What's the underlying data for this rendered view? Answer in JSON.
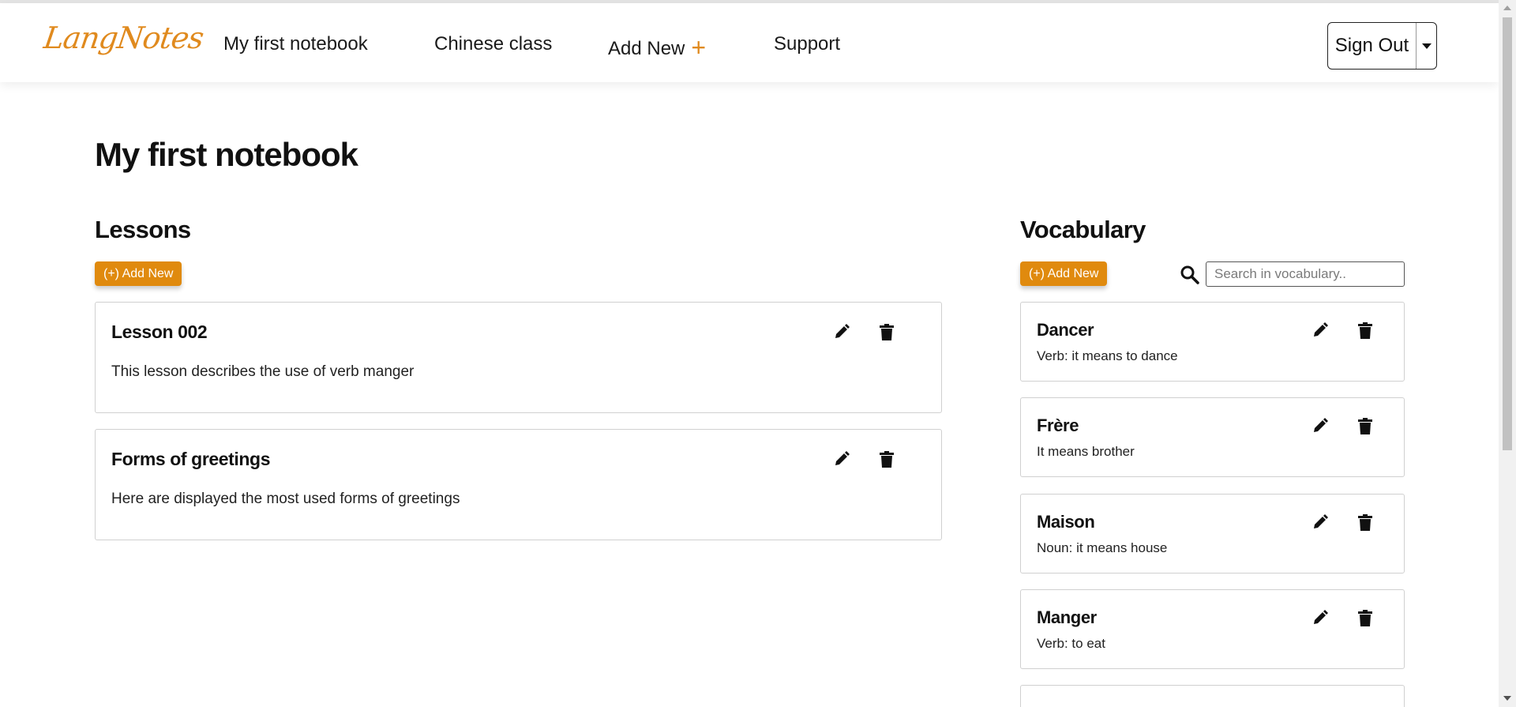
{
  "app": {
    "logo_text": "LangNotes"
  },
  "nav": {
    "items": [
      {
        "label": "My first notebook"
      },
      {
        "label": "Chinese class"
      },
      {
        "label": "Add New",
        "icon": "plus-icon"
      },
      {
        "label": "Support"
      }
    ],
    "signout_label": "Sign Out"
  },
  "page": {
    "title": "My first notebook"
  },
  "lessons": {
    "title": "Lessons",
    "add_label": "(+) Add New",
    "items": [
      {
        "title": "Lesson 002",
        "description": "This lesson describes the use of verb manger"
      },
      {
        "title": "Forms of greetings",
        "description": "Here are displayed the most used forms of greetings"
      }
    ]
  },
  "vocabulary": {
    "title": "Vocabulary",
    "add_label": "(+) Add New",
    "search_placeholder": "Search in vocabulary..",
    "items": [
      {
        "word": "Dancer",
        "meaning": "Verb: it means to dance"
      },
      {
        "word": "Frère",
        "meaning": "It means brother"
      },
      {
        "word": "Maison",
        "meaning": "Noun: it means house"
      },
      {
        "word": "Manger",
        "meaning": "Verb: to eat"
      }
    ]
  },
  "colors": {
    "accent": "#e08a0e",
    "card_border": "#d0d0d0"
  },
  "icons": {
    "edit": "pencil-icon",
    "delete": "trash-icon",
    "search": "search-icon",
    "caret": "caret-down-icon"
  }
}
